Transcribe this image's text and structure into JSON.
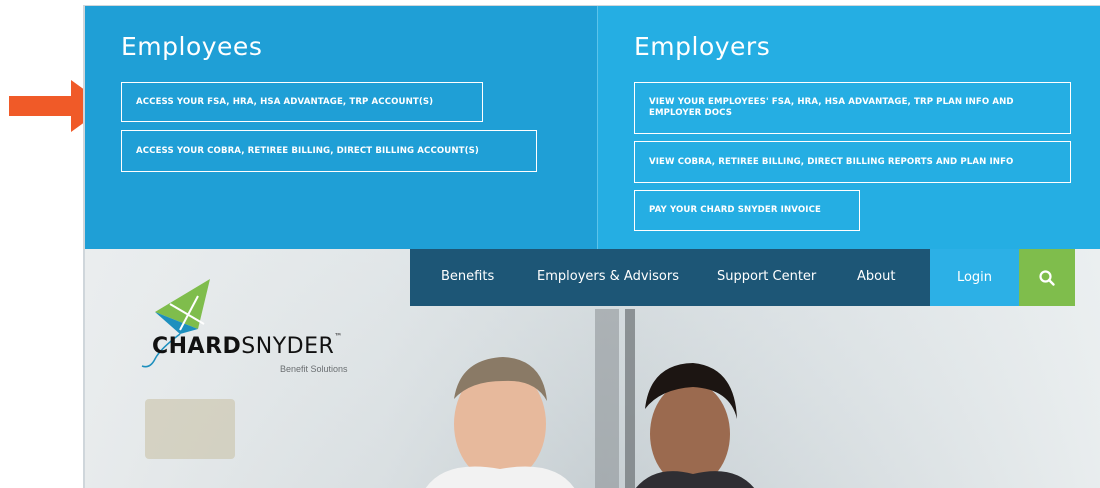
{
  "employees": {
    "heading": "Employees",
    "buttons": [
      "ACCESS YOUR FSA, HRA, HSA ADVANTAGE, TRP ACCOUNT(S)",
      "ACCESS YOUR COBRA, RETIREE BILLING, DIRECT BILLING ACCOUNT(S)"
    ]
  },
  "employers": {
    "heading": "Employers",
    "buttons": [
      "VIEW YOUR EMPLOYEES' FSA, HRA, HSA ADVANTAGE, TRP PLAN INFO AND EMPLOYER DOCS",
      "VIEW COBRA, RETIREE BILLING, DIRECT BILLING REPORTS AND PLAN INFO",
      "PAY YOUR CHARD SNYDER INVOICE"
    ]
  },
  "nav": {
    "items": [
      "Benefits",
      "Employers & Advisors",
      "Support Center",
      "About"
    ],
    "login": "Login",
    "search_icon": "search-icon"
  },
  "logo": {
    "brand_bold": "CHARD",
    "brand_light": "SNYDER",
    "tm": "™",
    "tagline": "Benefit Solutions"
  },
  "colors": {
    "employees_bg": "#1f9fd6",
    "employers_bg": "#25aee3",
    "nav_bg": "#1d5676",
    "login_bg": "#2cb0e6",
    "search_bg": "#7fbd4c",
    "arrow": "#f05a28"
  }
}
